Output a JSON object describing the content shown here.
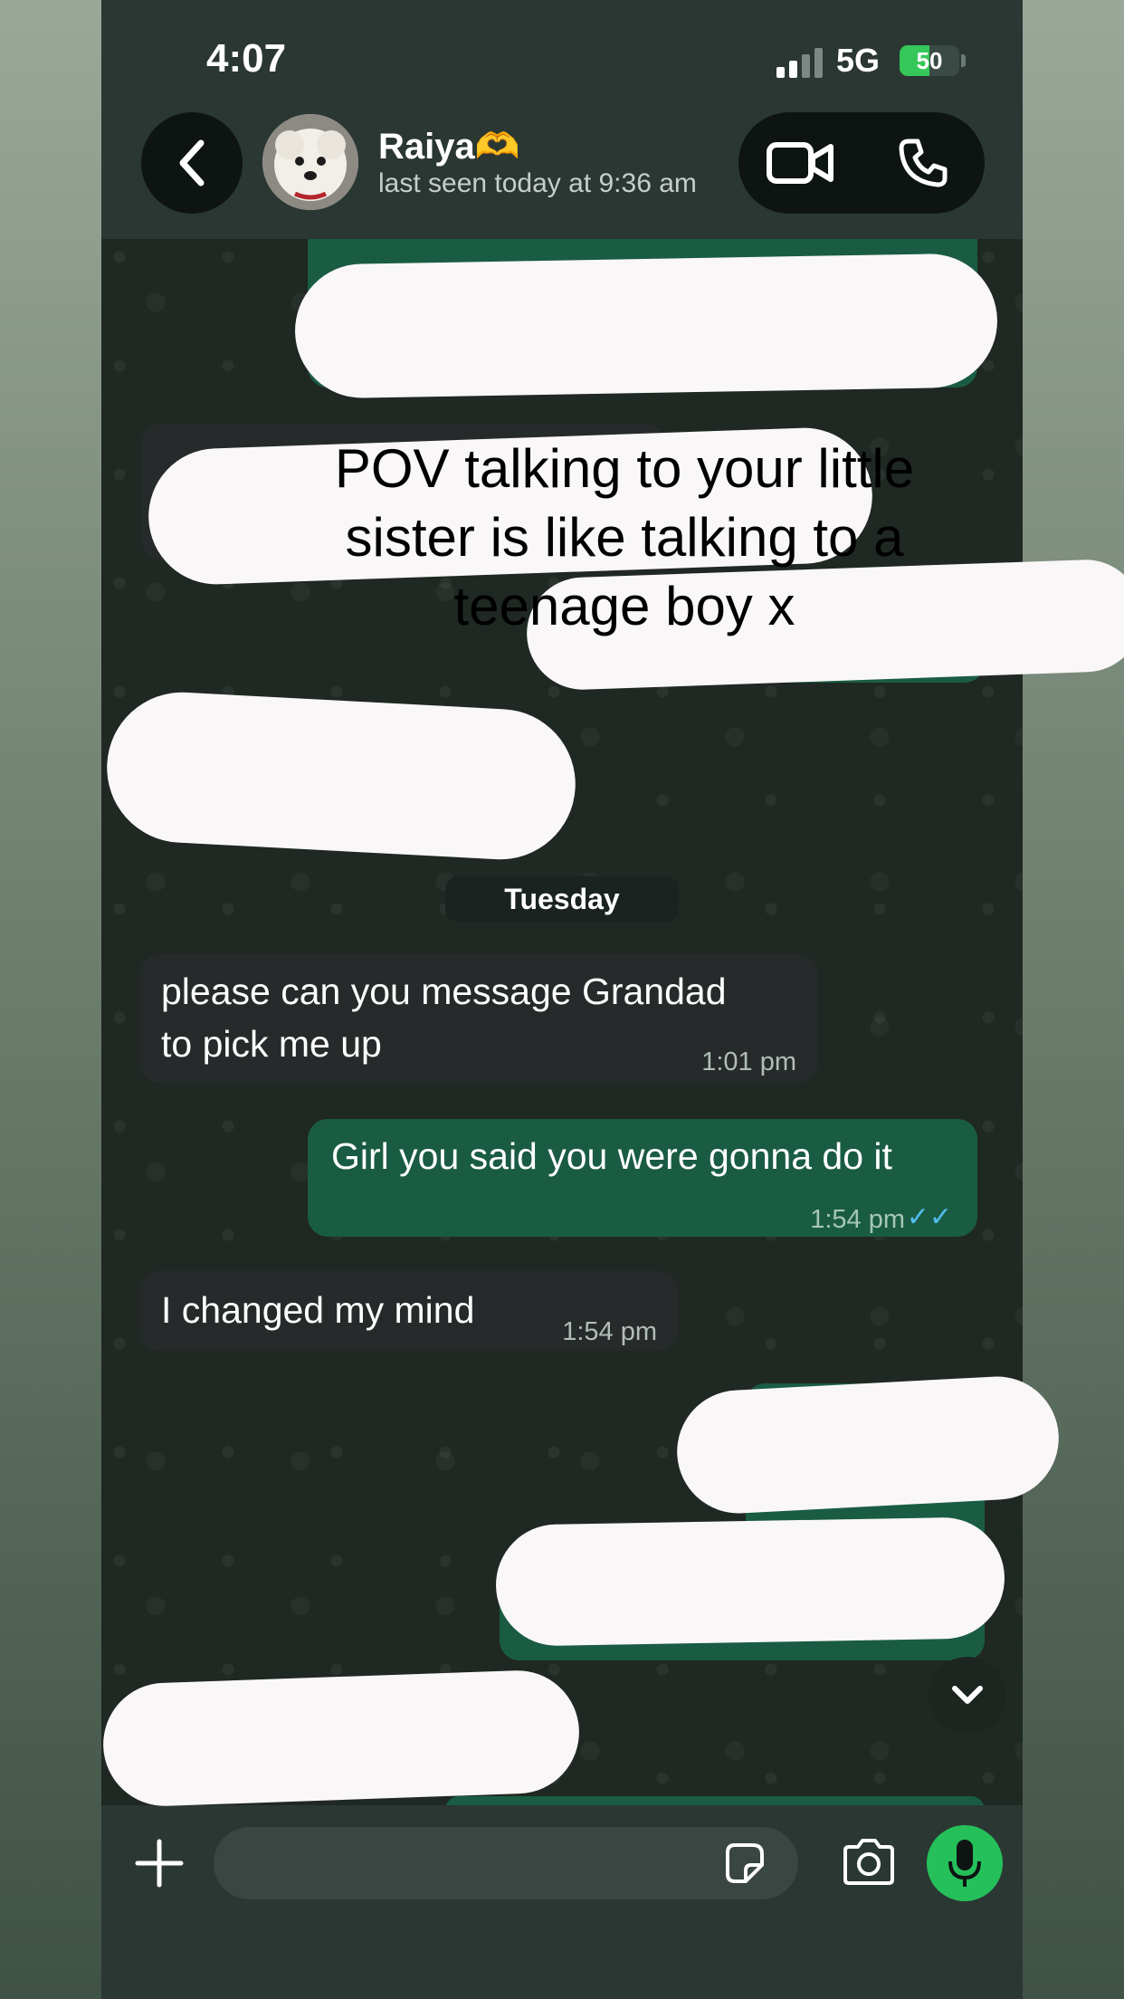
{
  "status_bar": {
    "time": "4:07",
    "network": "5G",
    "battery": "50",
    "battery_level": 0.5
  },
  "header": {
    "contact_name": "Raiya🫶",
    "last_seen": "last seen today at 9:36 am"
  },
  "caption": {
    "line1": "POV talking to your little",
    "line2": "sister is like talking to a",
    "line3": "teenage boy x"
  },
  "chat": {
    "date_label": "Tuesday",
    "messages": [
      {
        "direction": "in",
        "line1": "please can you message Grandad",
        "line2": "to pick me up",
        "time": "1:01 pm"
      },
      {
        "direction": "out",
        "text": "Girl you said you were gonna do it",
        "time": "1:54 pm",
        "status": "read"
      },
      {
        "direction": "in",
        "text": "I changed my mind",
        "time": "1:54 pm"
      }
    ]
  },
  "colors": {
    "incoming_bubble": "#262a2b",
    "outgoing_bubble": "#1a5c43",
    "accent_green": "#25c05a",
    "read_ticks": "#53bdeb"
  },
  "icons": [
    "back-chevron-icon",
    "video-call-icon",
    "phone-icon",
    "chevron-down-icon",
    "plus-icon",
    "sticker-icon",
    "camera-icon",
    "microphone-icon"
  ]
}
